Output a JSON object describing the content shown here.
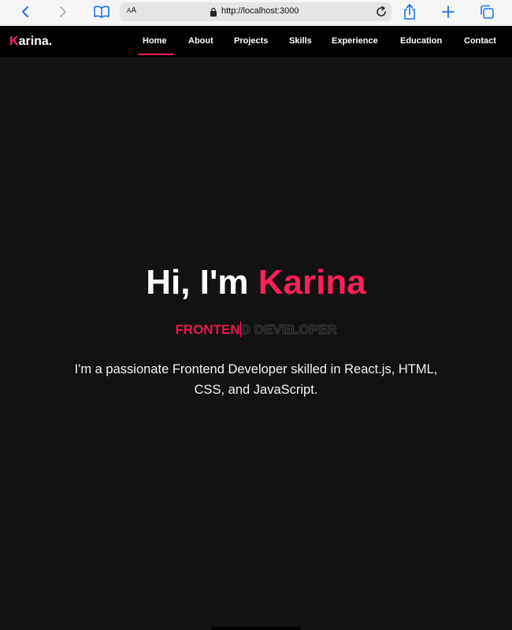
{
  "browser": {
    "text_size_label_small": "A",
    "text_size_label_large": "A",
    "url": "http://localhost:3000"
  },
  "site": {
    "logo_initial": "K",
    "logo_rest": "arina.",
    "nav": [
      {
        "label": "Home",
        "active": true
      },
      {
        "label": "About",
        "active": false
      },
      {
        "label": "Projects",
        "active": false
      },
      {
        "label": "Skills",
        "active": false
      },
      {
        "label": "Experience",
        "active": false
      },
      {
        "label": "Education",
        "active": false
      },
      {
        "label": "Contact",
        "active": false
      }
    ]
  },
  "hero": {
    "greeting": "Hi, I'm ",
    "name": "Karina",
    "typed_text": "FRONTEN",
    "remaining_text": "D DEVELOPER",
    "description": "I'm a passionate Frontend Developer skilled in React.js, HTML, CSS, and JavaScript."
  },
  "colors": {
    "accent": "#ff1f5a",
    "background": "#121212",
    "nav_background": "#000000"
  }
}
